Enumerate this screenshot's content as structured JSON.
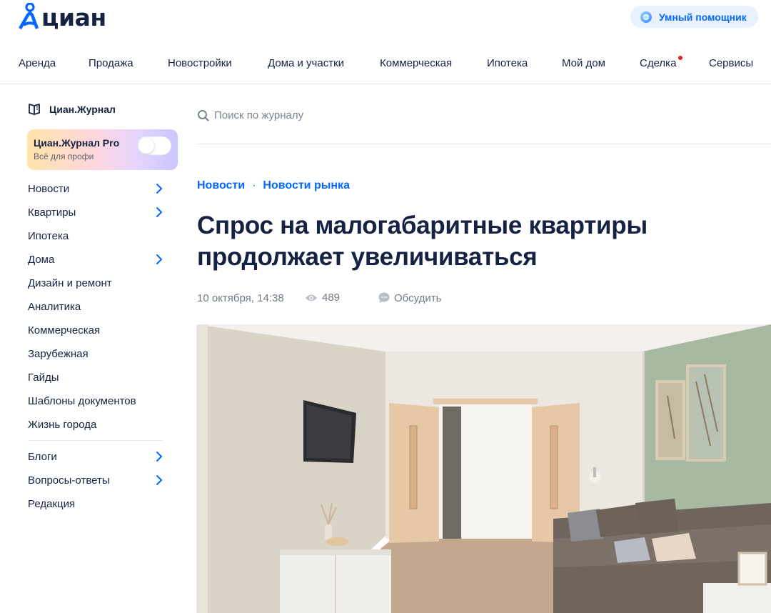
{
  "brand": {
    "logo_text": "циан",
    "accent": "#0468ff",
    "dark": "#152242"
  },
  "header": {
    "assistant_label": "Умный помощник",
    "nav": [
      {
        "label": "Аренда"
      },
      {
        "label": "Продажа"
      },
      {
        "label": "Новостройки"
      },
      {
        "label": "Дома и участки"
      },
      {
        "label": "Коммерческая"
      },
      {
        "label": "Ипотека"
      },
      {
        "label": "Мой дом"
      },
      {
        "label": "Сделка",
        "badge": "red-dot"
      },
      {
        "label": "Сервисы"
      }
    ]
  },
  "sidebar": {
    "journal_label": "Циан.Журнал",
    "pro": {
      "title": "Циан.Журнал Pro",
      "subtitle": "Всё для профи",
      "toggle_on": false
    },
    "items": [
      {
        "label": "Новости",
        "chevron": true
      },
      {
        "label": "Квартиры",
        "chevron": true
      },
      {
        "label": "Ипотека",
        "chevron": false
      },
      {
        "label": "Дома",
        "chevron": true
      },
      {
        "label": "Дизайн и ремонт",
        "chevron": false
      },
      {
        "label": "Аналитика",
        "chevron": false
      },
      {
        "label": "Коммерческая",
        "chevron": false
      },
      {
        "label": "Зарубежная",
        "chevron": false
      },
      {
        "label": "Гайды",
        "chevron": false
      },
      {
        "label": "Шаблоны документов",
        "chevron": false
      },
      {
        "label": "Жизнь города",
        "chevron": false
      },
      {
        "label": "Блоги",
        "chevron": true
      },
      {
        "label": "Вопросы-ответы",
        "chevron": true
      },
      {
        "label": "Редакция",
        "chevron": false
      }
    ]
  },
  "search": {
    "placeholder": "Поиск по журналу",
    "value": ""
  },
  "article": {
    "breadcrumbs": [
      {
        "label": "Новости"
      },
      {
        "label": "Новости рынка"
      }
    ],
    "breadcrumb_separator": "·",
    "title": "Спрос на малогабаритные квартиры продолжает увеличиваться",
    "date": "10 октября, 14:38",
    "views": "489",
    "discuss_label": "Обсудить"
  }
}
